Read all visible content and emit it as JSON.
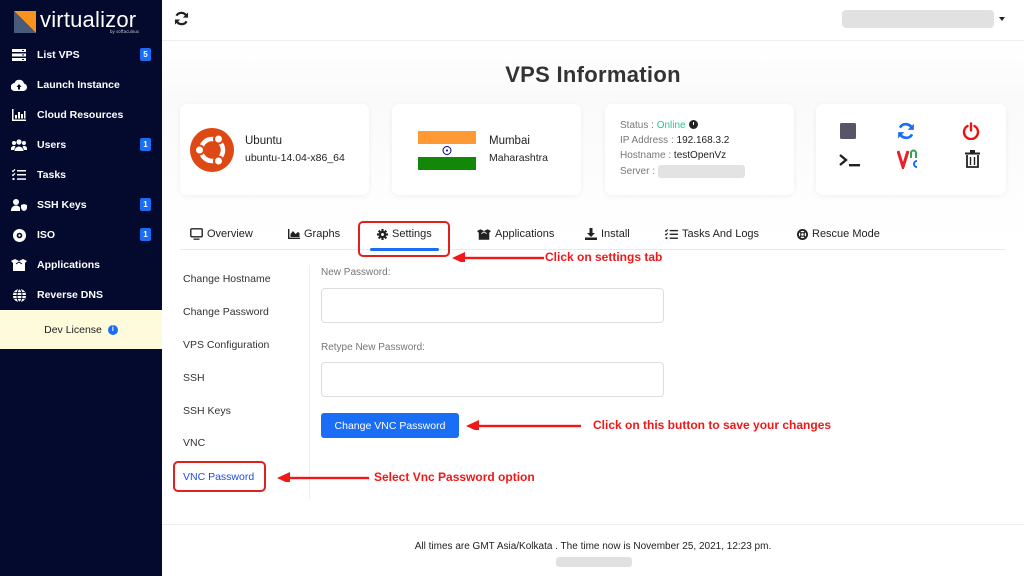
{
  "app": {
    "brand": "virtualizor",
    "brand_sub": "by softaculous"
  },
  "sidebar": {
    "items": [
      {
        "label": "List VPS",
        "icon": "server-list-icon",
        "badge": "5"
      },
      {
        "label": "Launch Instance",
        "icon": "cloud-upload-icon",
        "badge": null
      },
      {
        "label": "Cloud Resources",
        "icon": "bar-chart-icon",
        "badge": null
      },
      {
        "label": "Users",
        "icon": "users-icon",
        "badge": "1"
      },
      {
        "label": "Tasks",
        "icon": "tasks-list-icon",
        "badge": null
      },
      {
        "label": "SSH Keys",
        "icon": "user-shield-icon",
        "badge": "1"
      },
      {
        "label": "ISO",
        "icon": "disc-icon",
        "badge": "1"
      },
      {
        "label": "Applications",
        "icon": "box-open-icon",
        "badge": null
      },
      {
        "label": "Reverse DNS",
        "icon": "globe-icon",
        "badge": null
      }
    ],
    "license": {
      "label": "Dev License",
      "icon": "info-icon"
    }
  },
  "topbar": {
    "refresh_icon": "refresh-icon",
    "user_menu_icon": "caret-down-icon"
  },
  "page": {
    "title": "VPS Information"
  },
  "os_card": {
    "name": "Ubuntu",
    "version": "ubuntu-14.04-x86_64",
    "icon": "ubuntu-logo-icon"
  },
  "location_card": {
    "city": "Mumbai",
    "region": "Maharashtra",
    "icon": "india-flag-icon"
  },
  "status_card": {
    "status_label": "Status : ",
    "status_value": "Online",
    "ip_label": "IP Address : ",
    "ip_value": "192.168.3.2",
    "hostname_label": "Hostname : ",
    "hostname_value": "testOpenVz",
    "server_label": "Server : "
  },
  "actions": [
    {
      "name": "stop-button",
      "icon": "stop-icon",
      "color": "#5a5566"
    },
    {
      "name": "restart-button",
      "icon": "sync-icon",
      "color": "#1a6df5"
    },
    {
      "name": "power-off-button",
      "icon": "power-icon",
      "color": "#e81414"
    },
    {
      "name": "console-button",
      "icon": "terminal-icon",
      "color": "#222222"
    },
    {
      "name": "vnc-button",
      "icon": "vnc-icon",
      "color": "#e8202a"
    },
    {
      "name": "delete-button",
      "icon": "trash-icon",
      "color": "#222222"
    }
  ],
  "tabs": [
    {
      "label": "Overview",
      "icon": "monitor-icon"
    },
    {
      "label": "Graphs",
      "icon": "area-chart-icon"
    },
    {
      "label": "Settings",
      "icon": "gear-icon",
      "active": true
    },
    {
      "label": "Applications",
      "icon": "box-open-icon"
    },
    {
      "label": "Install",
      "icon": "download-icon"
    },
    {
      "label": "Tasks And Logs",
      "icon": "tasks-list-icon"
    },
    {
      "label": "Rescue Mode",
      "icon": "life-ring-icon"
    }
  ],
  "settings_menu": [
    {
      "label": "Change Hostname"
    },
    {
      "label": "Change Password"
    },
    {
      "label": "VPS Configuration"
    },
    {
      "label": "SSH"
    },
    {
      "label": "SSH Keys"
    },
    {
      "label": "VNC"
    },
    {
      "label": "VNC Password",
      "active": true
    }
  ],
  "form": {
    "new_password_label": "New Password:",
    "new_password_value": "",
    "retype_label": "Retype New Password:",
    "retype_value": "",
    "submit_label": "Change VNC Password"
  },
  "annotations": {
    "settings_tab": "Click on settings tab",
    "save_button": "Click on this button to save your changes",
    "vnc_option": "Select Vnc Password option",
    "color": "#f01818"
  },
  "footer": {
    "text": "All times are GMT Asia/Kolkata . The time now is November 25, 2021, 12:23 pm."
  },
  "colors": {
    "sidebar_bg": "#030a2e",
    "accent": "#1a6df5",
    "online": "#22c887",
    "license_bg": "#fdfbdc"
  }
}
